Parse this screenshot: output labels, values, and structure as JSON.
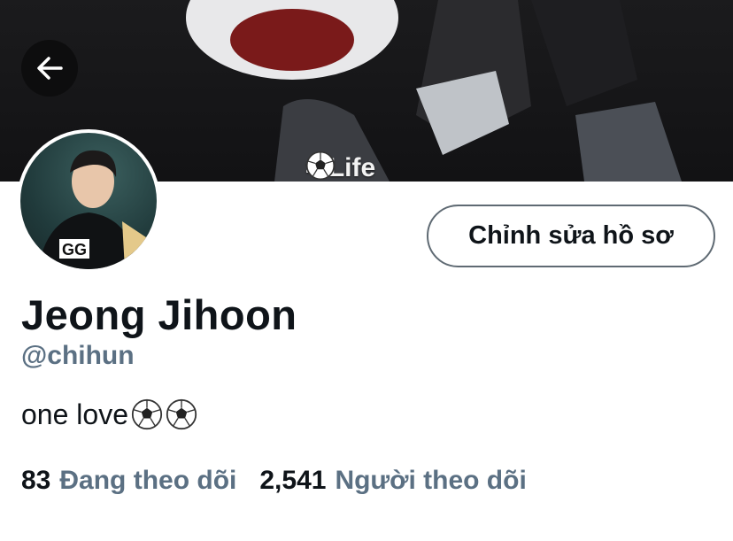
{
  "header": {
    "back_icon": "arrow-left-icon",
    "banner_caption_text": "= Life",
    "banner_caption_icon": "soccer-ball-icon"
  },
  "profile": {
    "display_name": "Jeong Jihoon",
    "handle": "@chihun",
    "bio_text": "one love",
    "bio_icons": [
      "soccer-ball-icon",
      "soccer-ball-icon"
    ],
    "edit_button_label": "Chỉnh sửa hồ sơ"
  },
  "stats": {
    "following_count": "83",
    "following_label": "Đang theo dõi",
    "followers_count": "2,541",
    "followers_label": "Người theo dõi"
  },
  "colors": {
    "primary_text": "#0f1419",
    "secondary_text": "#5b7083",
    "button_border": "#5f6a73",
    "back_button_bg": "#0d0d0e"
  }
}
